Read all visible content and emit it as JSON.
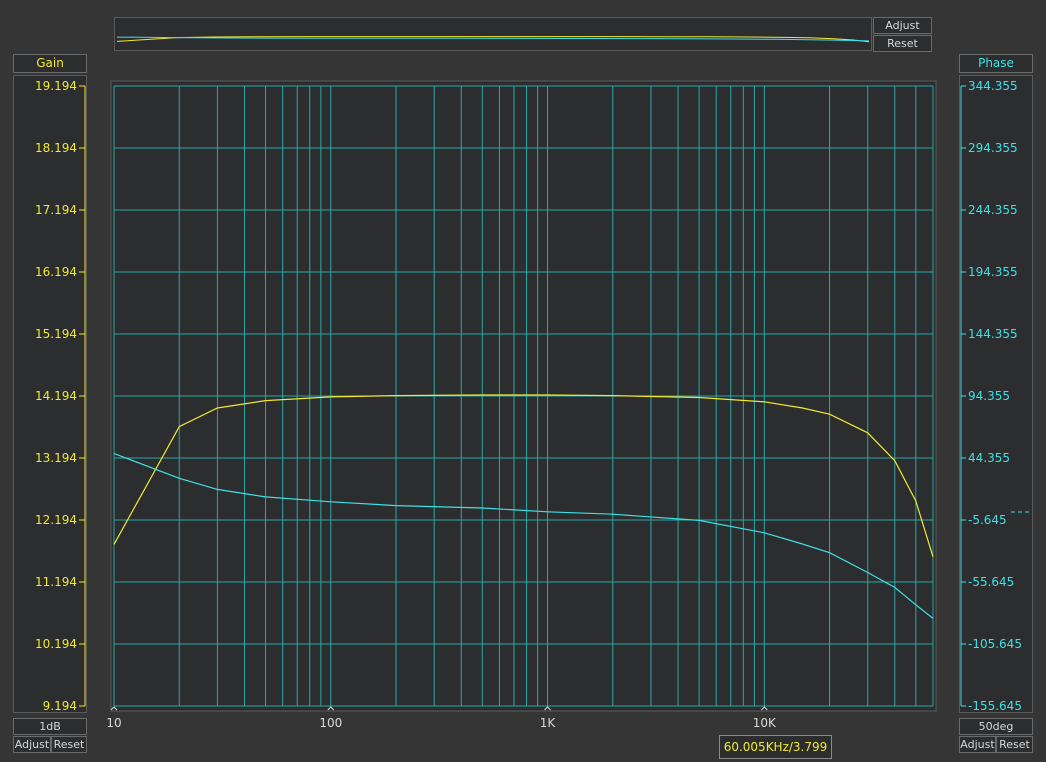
{
  "overview": {
    "adjust_label": "Adjust",
    "reset_label": "Reset"
  },
  "left_axis": {
    "title": "Gain",
    "scale_label": "1dB",
    "adjust_label": "Adjust",
    "reset_label": "Reset",
    "ticks": [
      "19.194",
      "18.194",
      "17.194",
      "16.194",
      "15.194",
      "14.194",
      "13.194",
      "12.194",
      "11.194",
      "10.194",
      "9.194"
    ]
  },
  "right_axis": {
    "title": "Phase",
    "scale_label": "50deg",
    "adjust_label": "Adjust",
    "reset_label": "Reset",
    "ticks": [
      "344.355",
      "294.355",
      "244.355",
      "194.355",
      "144.355",
      "94.355",
      "44.355",
      "-5.645",
      "-55.645",
      "-105.645",
      "-155.645"
    ]
  },
  "x_axis": {
    "ticks": [
      "10",
      "100",
      "1K",
      "10K"
    ]
  },
  "cursor_readout": "60.005KHz/3.799",
  "colors": {
    "gain": "#f2e930",
    "phase": "#3fe0e6",
    "grid": "#2aa8a8",
    "plot_bg": "#2b2d2e"
  },
  "chart_data": {
    "type": "line",
    "x_scale": "log",
    "xlim": [
      10,
      60005
    ],
    "grid": true,
    "series": [
      {
        "name": "Gain",
        "axis": "left",
        "unit": "dB",
        "ylim": [
          9.194,
          19.194
        ],
        "x": [
          10,
          20,
          30,
          50,
          100,
          200,
          500,
          1000,
          2000,
          5000,
          10000,
          15000,
          20000,
          30000,
          40000,
          50000,
          60005
        ],
        "values": [
          11.8,
          13.7,
          14.0,
          14.12,
          14.18,
          14.2,
          14.21,
          14.21,
          14.2,
          14.17,
          14.1,
          14.0,
          13.9,
          13.6,
          13.15,
          12.5,
          11.6
        ]
      },
      {
        "name": "Phase",
        "axis": "right",
        "unit": "deg",
        "ylim": [
          -155.645,
          344.355
        ],
        "x": [
          10,
          20,
          30,
          50,
          100,
          200,
          500,
          1000,
          2000,
          5000,
          10000,
          15000,
          20000,
          30000,
          40000,
          50000,
          60005
        ],
        "values": [
          48,
          28,
          19,
          13,
          9,
          6,
          4,
          1,
          -1,
          -6,
          -16,
          -25,
          -32,
          -48,
          -60,
          -74,
          -85
        ]
      }
    ]
  }
}
